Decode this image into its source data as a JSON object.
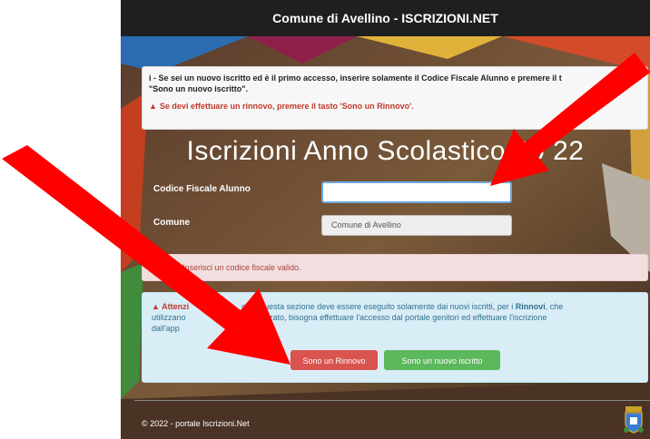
{
  "header": {
    "title": "Comune di Avellino - ISCRIZIONI.NET"
  },
  "info_box": {
    "line1": "i - Se sei un nuovo iscritto ed è il primo accesso, inserire solamente il Codice Fiscale Alunno e premere il t",
    "line1b": "\"Sono un nuovo iscritto\".",
    "line2": "Se devi effettuare un rinnovo, premere il tasto 'Sono un Rinnovo'."
  },
  "page_title": "Iscrizioni Anno Scolastico 20      22",
  "form": {
    "codice_label": "Codice Fiscale Alunno",
    "codice_value": "",
    "comune_label": "Comune",
    "comune_value": "Comune di Avellino"
  },
  "alert": {
    "strong": "nzione!",
    "text": " Inserisci un codice fiscale valido."
  },
  "notice": {
    "warn": "Attenzi",
    "text1": "o da questa sezione deve essere eseguito solamente dai nuovi iscritti, per i",
    "bold": "Rinnovi",
    "text2": ", che",
    "line2a": "utilizzano",
    "line2b": "ormatizzato, bisogna effettuare l'accesso dal portale genitori ed effettuare l'iscrizione",
    "line3": "dall'app"
  },
  "buttons": {
    "rinnovo": "Sono un Rinnovo",
    "nuovo": "Sono un nuovo iscritto"
  },
  "footer": {
    "text": "© 2022 - portale Iscrizioni.Net"
  },
  "colors": {
    "arrow": "#ff0000",
    "danger": "#d9534f",
    "success": "#5cb85c",
    "topbar": "#1f1f1f"
  }
}
